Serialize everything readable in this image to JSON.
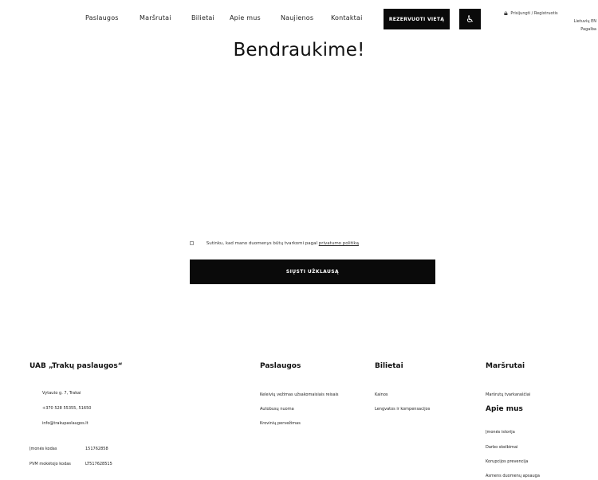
{
  "nav": {
    "links": [
      "Paslaugos",
      "Maršrutai",
      "Bilietai",
      "Apie mus",
      "Naujienos",
      "Kontaktai"
    ],
    "cta_label": "Rezervuoti vietą",
    "accessibility_glyph": "♿",
    "account": {
      "line1": "Prisijungti / Registruotis",
      "line2": "Lietuvių  EN",
      "line3": "Pagalba"
    }
  },
  "page": {
    "title": "Bendraukime!"
  },
  "form": {
    "consent_text": "Sutinku, kad mano duomenys būtų tvarkomi pagal",
    "consent_link": "privatumo politiką",
    "submit_label": "Siųsti užklausą"
  },
  "footer": {
    "company": {
      "title": "UAB „Trakų paslaugos“",
      "address": "Vytauto g. 7, Trakai",
      "phone": "+370 528 55355, 51650",
      "email": "info@trakupaslaugos.lt",
      "company_code_label": "Įmonės kodas",
      "company_code": "151762858",
      "vat_label": "PVM mokėtojo kodas",
      "vat": "LT517628515"
    },
    "services": {
      "title": "Paslaugos",
      "items": [
        "Keleivių vežimas užsakomaisiais reisais",
        "Autobusų nuoma",
        "Krovinių pervežimas"
      ]
    },
    "tickets": {
      "title": "Bilietai",
      "items": [
        "Kainos",
        "Lengvatos ir kompensacijos"
      ]
    },
    "routes": {
      "title": "Maršrutai",
      "items": [
        "Maršrutų tvarkaraščiai"
      ],
      "about_title": "Apie mus",
      "about_items": [
        "Įmonės istorija",
        "Darbo skelbimai",
        "Korupcijos prevencija",
        "Asmens duomenų apsauga"
      ]
    }
  }
}
